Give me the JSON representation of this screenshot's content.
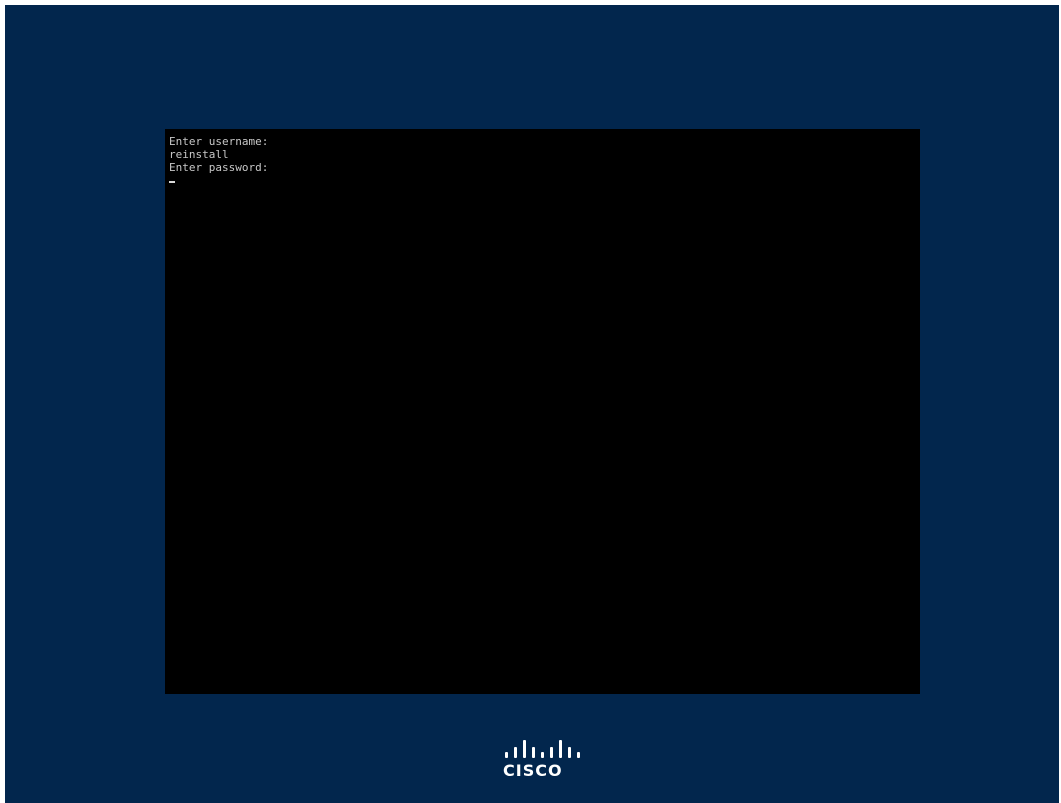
{
  "console": {
    "lines": [
      "Enter username:",
      "reinstall",
      "Enter password:"
    ],
    "cursor": "_"
  },
  "logo": {
    "text": "CISCO"
  },
  "colors": {
    "background": "#02264d",
    "console_bg": "#000000",
    "console_text": "#c8c8c8",
    "logo": "#ffffff"
  }
}
